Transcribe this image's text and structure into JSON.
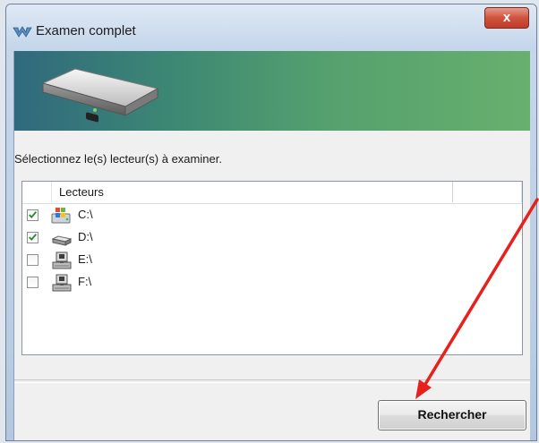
{
  "window": {
    "title": "Examen complet",
    "close_label": "x"
  },
  "instructions": "Sélectionnez le(s) lecteur(s) à examiner.",
  "list": {
    "column_header": "Lecteurs",
    "drives": [
      {
        "label": "C:\\",
        "checked": true,
        "icon": "windows-drive-icon"
      },
      {
        "label": "D:\\",
        "checked": true,
        "icon": "hard-drive-icon"
      },
      {
        "label": "E:\\",
        "checked": false,
        "icon": "network-drive-icon"
      },
      {
        "label": "F:\\",
        "checked": false,
        "icon": "network-drive-icon"
      }
    ]
  },
  "search_button": "Rechercher",
  "colors": {
    "annotation_arrow": "#e8201b",
    "banner_start": "#30697e",
    "banner_end": "#67b06e",
    "checkmark": "#2d8a2d"
  }
}
